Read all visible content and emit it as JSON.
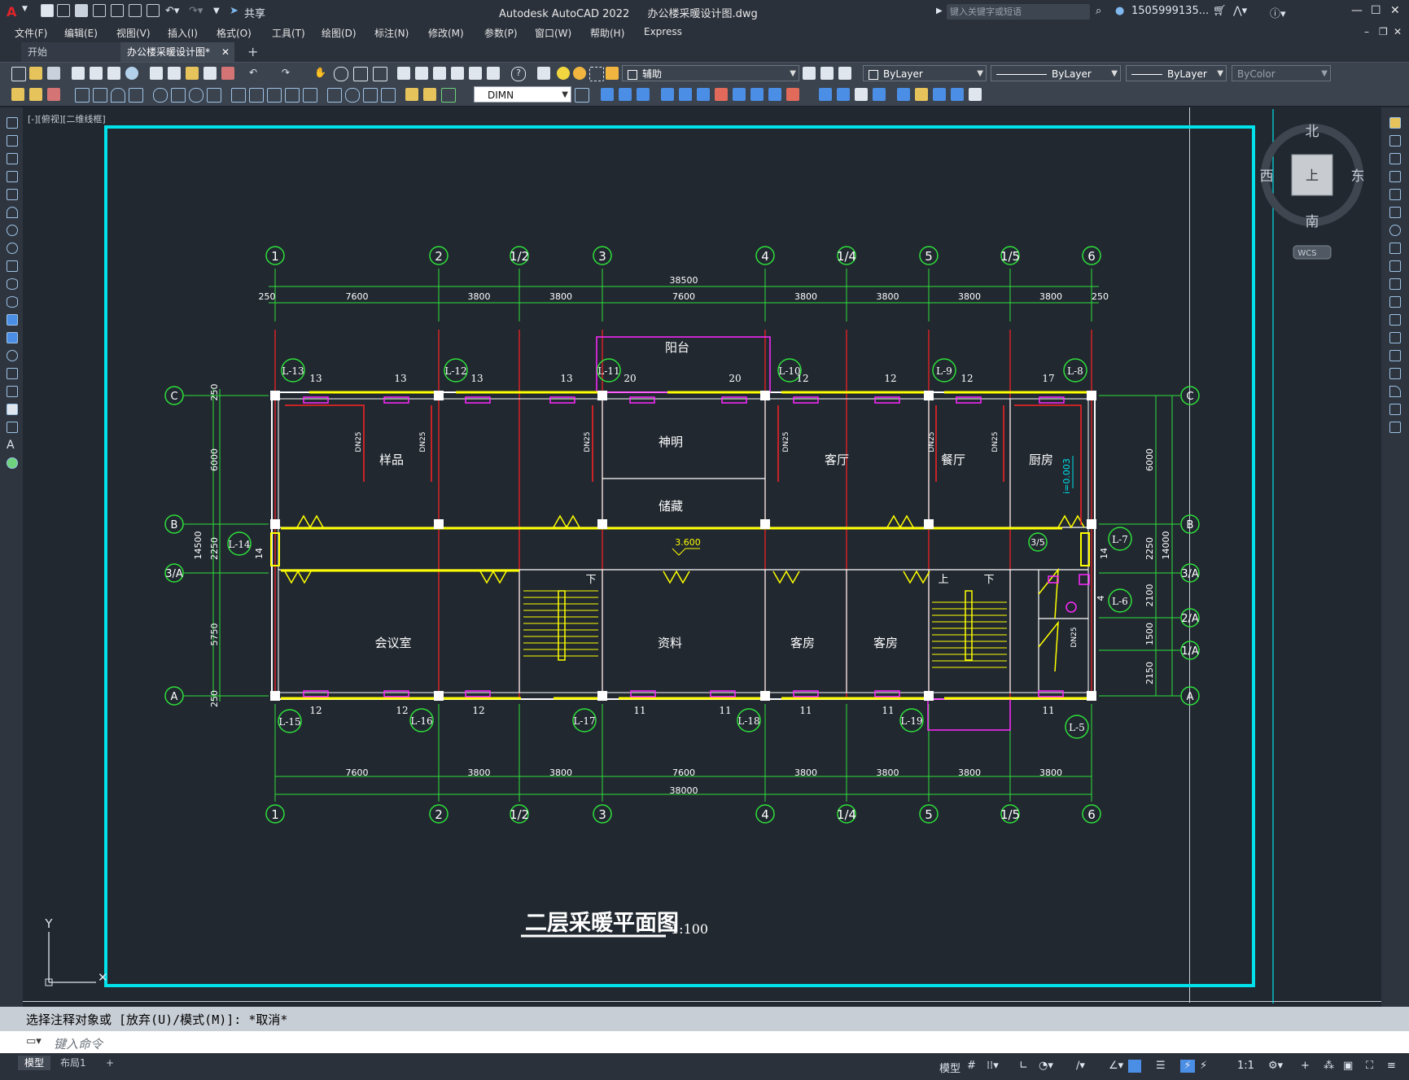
{
  "app": {
    "title": "Autodesk AutoCAD 2022",
    "filename": "办公楼采暖设计图.dwg",
    "share_label": "共享",
    "search_placeholder": "键入关键字或短语",
    "user": "1505999135..."
  },
  "menu": [
    "文件(F)",
    "编辑(E)",
    "视图(V)",
    "插入(I)",
    "格式(O)",
    "工具(T)",
    "绘图(D)",
    "标注(N)",
    "修改(M)",
    "参数(P)",
    "窗口(W)",
    "帮助(H)",
    "Express"
  ],
  "tabs": {
    "start": "开始",
    "active": "办公楼采暖设计图*",
    "add": "+"
  },
  "properties": {
    "layer": "辅助",
    "color": "ByLayer",
    "linetype": "ByLayer",
    "lineweight": "ByLayer",
    "plotstyle": "ByColor",
    "dimstyle": "DIMN"
  },
  "viewport": {
    "label": "[-][俯视][二维线框]"
  },
  "viewcube": {
    "north": "北",
    "south": "南",
    "east": "东",
    "west": "西",
    "face": "上",
    "wcs": "WCS"
  },
  "drawing": {
    "title": "二层采暖平面图",
    "scale": "1:100",
    "axes_top": [
      "1",
      "2",
      "1/2",
      "3",
      "4",
      "1/4",
      "5",
      "1/5",
      "6"
    ],
    "axes_side_left": [
      "C",
      "B",
      "3/A",
      "A"
    ],
    "axes_side_right": [
      "C",
      "B",
      "3/A",
      "2/A",
      "1/A",
      "A"
    ],
    "dims_top_total": "38500",
    "dims_top": [
      "250",
      "7600",
      "3800",
      "3800",
      "7600",
      "3800",
      "3800",
      "3800",
      "3800",
      "250"
    ],
    "dims_bottom": [
      "7600",
      "3800",
      "3800",
      "7600",
      "3800",
      "3800",
      "3800",
      "3800"
    ],
    "dims_bottom_total": "38000",
    "dims_left": [
      "250",
      "6000",
      "2250",
      "5750",
      "250"
    ],
    "dims_left_total": "14500",
    "dims_right": [
      "6000",
      "2250",
      "2100",
      "1500",
      "2150"
    ],
    "dims_right_total": "14000",
    "rooms": {
      "yangpin": "样品",
      "shenming": "神明",
      "chucang": "储藏",
      "keting": "客厅",
      "canting": "餐厅",
      "chufang": "厨房",
      "huiyishi": "会议室",
      "ziliao": "资料",
      "kefang1": "客房",
      "kefang2": "客房",
      "balcony": "阳台"
    },
    "risers": {
      "l13": "L-13",
      "l12": "L-12",
      "l11": "L-11",
      "l10": "L-10",
      "l9": "L-9",
      "l8": "L-8",
      "l7": "L-7",
      "l6": "L-6",
      "l5": "L-5",
      "l14": "L-14",
      "l15": "L-15",
      "l16": "L-16",
      "l17": "L-17",
      "l18": "L-18",
      "l19": "L-19"
    },
    "rad_top": [
      "13",
      "13",
      "13",
      "13",
      "20",
      "20",
      "12",
      "12",
      "12",
      "17"
    ],
    "rad_bottom": [
      "12",
      "12",
      "12",
      "11",
      "11",
      "11",
      "11",
      "11"
    ],
    "rad_side": [
      "14",
      "14",
      "4"
    ],
    "pipe": "DN25",
    "slope": "i=0.003",
    "elevation": "3.600",
    "up": "上",
    "down": "下",
    "axis_35": "3/5"
  },
  "command": {
    "history": "选择注释对象或 [放弃(U)/模式(M)]: *取消*",
    "placeholder": "键入命令"
  },
  "status": {
    "model_tab": "模型",
    "layout_tab": "布局1",
    "model_btn": "模型",
    "scale": "1:1"
  }
}
